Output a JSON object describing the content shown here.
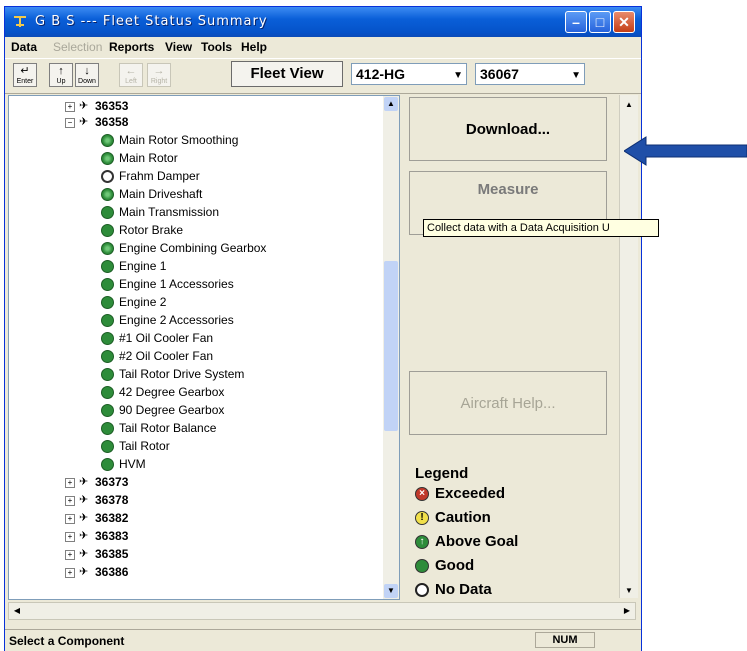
{
  "window": {
    "title": "G B S --- Fleet Status Summary"
  },
  "menu": {
    "items": [
      {
        "label": "Data",
        "enabled": true
      },
      {
        "label": "Selection",
        "enabled": false
      },
      {
        "label": "Reports",
        "enabled": true
      },
      {
        "label": "View",
        "enabled": true
      },
      {
        "label": "Tools",
        "enabled": true
      },
      {
        "label": "Help",
        "enabled": true
      }
    ]
  },
  "toolbar": {
    "buttons": [
      {
        "label": "Enter",
        "icon": "enter-icon"
      },
      {
        "label": "Up",
        "icon": "up-arrow-icon"
      },
      {
        "label": "Down",
        "icon": "down-arrow-icon"
      },
      {
        "label": "Left",
        "icon": "left-arrow-icon"
      },
      {
        "label": "Right",
        "icon": "right-arrow-icon"
      }
    ],
    "fleet_view_label": "Fleet View",
    "model_value": "412-HG",
    "serial_value": "36067"
  },
  "tree": {
    "top_nodes_before": [
      "36353"
    ],
    "expanded_node": "36358",
    "components": [
      {
        "label": "Main Rotor Smoothing",
        "status": "above"
      },
      {
        "label": "Main Rotor",
        "status": "above"
      },
      {
        "label": "Frahm Damper",
        "status": "nodata"
      },
      {
        "label": "Main Driveshaft",
        "status": "above"
      },
      {
        "label": "Main Transmission",
        "status": "good"
      },
      {
        "label": "Rotor Brake",
        "status": "good"
      },
      {
        "label": "Engine Combining Gearbox",
        "status": "above"
      },
      {
        "label": "Engine 1",
        "status": "good"
      },
      {
        "label": "Engine 1 Accessories",
        "status": "good"
      },
      {
        "label": "Engine 2",
        "status": "good"
      },
      {
        "label": "Engine 2 Accessories",
        "status": "good"
      },
      {
        "label": "#1 Oil Cooler Fan",
        "status": "good"
      },
      {
        "label": "#2 Oil Cooler Fan",
        "status": "good"
      },
      {
        "label": "Tail Rotor Drive System",
        "status": "good"
      },
      {
        "label": "42 Degree Gearbox",
        "status": "good"
      },
      {
        "label": "90 Degree Gearbox",
        "status": "good"
      },
      {
        "label": "Tail Rotor Balance",
        "status": "good"
      },
      {
        "label": "Tail Rotor",
        "status": "good"
      },
      {
        "label": "HVM",
        "status": "good"
      }
    ],
    "top_nodes_after": [
      "36373",
      "36378",
      "36382",
      "36383",
      "36385",
      "36386"
    ]
  },
  "actions": {
    "download_label": "Download...",
    "measure_label": "Measure",
    "aircraft_help_label": "Aircraft Help...",
    "tooltip": "Collect data with a Data Acquisition U"
  },
  "legend": {
    "title": "Legend",
    "items": [
      {
        "label": "Exceeded",
        "color": "#c0392b",
        "symbol": "×"
      },
      {
        "label": "Caution",
        "color": "#f1e04a",
        "symbol": "!"
      },
      {
        "label": "Above Goal",
        "color": "#2e8c3a",
        "symbol": "↑"
      },
      {
        "label": "Good",
        "color": "#2e8c3a",
        "symbol": ""
      },
      {
        "label": "No Data",
        "color": "#ffffff",
        "symbol": ""
      }
    ]
  },
  "status": {
    "text": "Select a Component",
    "num": "NUM"
  },
  "colors": {
    "title_bar": "#0a5fd8",
    "pointer_arrow": "#1f4fa8"
  }
}
